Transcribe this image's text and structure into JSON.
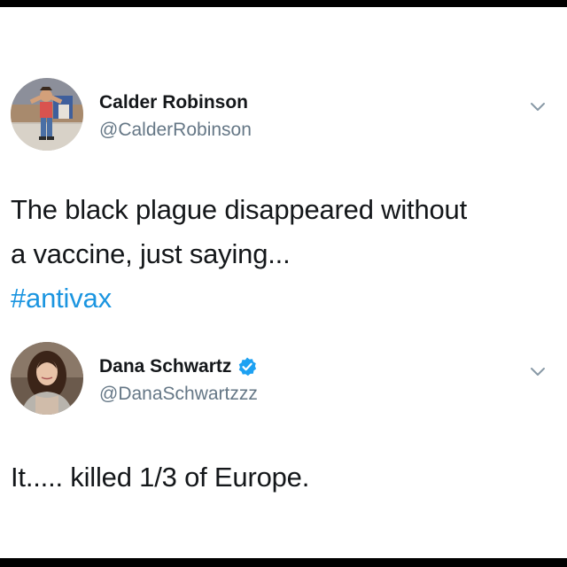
{
  "tweets": [
    {
      "author_name": "Calder Robinson",
      "author_handle": "@CalderRobinson",
      "verified": false,
      "text_line1": "The black plague disappeared without",
      "text_line2": "a vaccine, just saying...",
      "hashtag": "#antivax"
    },
    {
      "author_name": "Dana Schwartz",
      "author_handle": "@DanaSchwartzzz",
      "verified": true,
      "text_line1": "It..... killed 1/3 of Europe."
    }
  ],
  "colors": {
    "text": "#14171a",
    "handle": "#657786",
    "link": "#1b95e0",
    "verified_badge": "#1da1f2"
  },
  "icons": {
    "menu": "chevron-down-icon",
    "verified": "verified-badge-icon"
  }
}
